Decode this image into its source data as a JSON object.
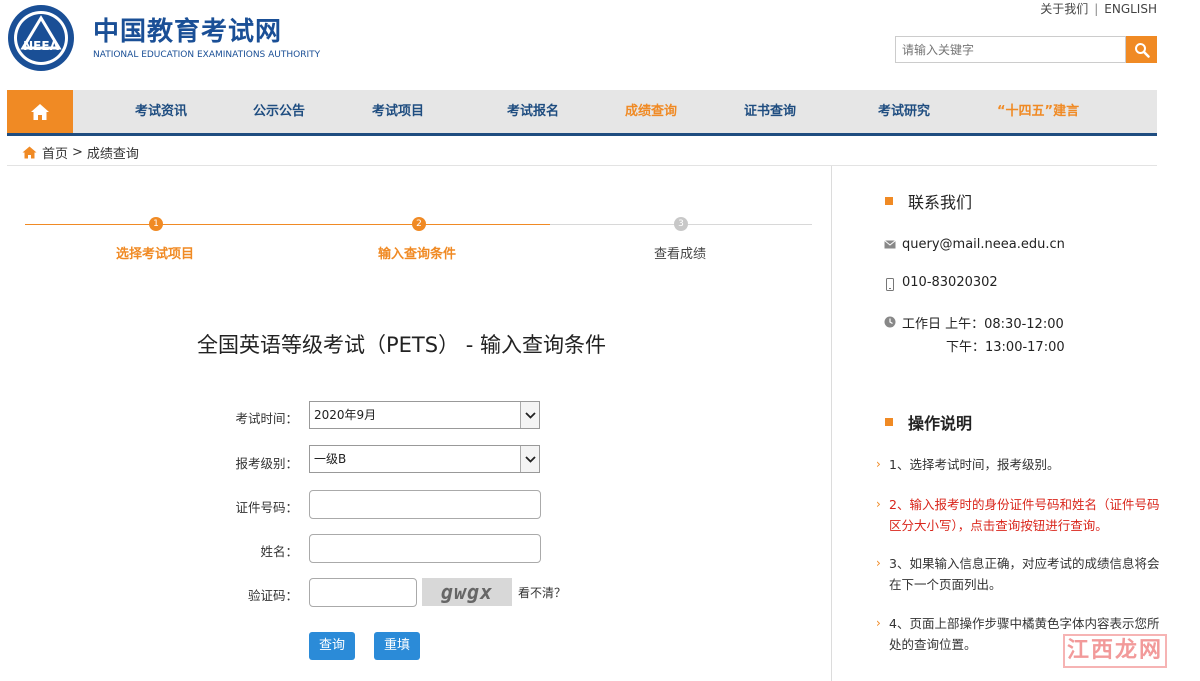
{
  "header": {
    "logo_cn": "中国教育考试网",
    "logo_en": "NATIONAL EDUCATION EXAMINATIONS AUTHORITY",
    "logo_badge": "NEEA",
    "top_links": {
      "about": "关于我们",
      "separator": "|",
      "english": "ENGLISH"
    },
    "search": {
      "placeholder": "请输入关键字",
      "icon": "search-icon"
    }
  },
  "nav": {
    "home_icon": "home-icon",
    "items": [
      {
        "label": "考试资讯"
      },
      {
        "label": "公示公告"
      },
      {
        "label": "考试项目"
      },
      {
        "label": "考试报名"
      },
      {
        "label": "成绩查询",
        "active": true
      },
      {
        "label": "证书查询"
      },
      {
        "label": "考试研究"
      },
      {
        "label": "“十四五”建言"
      }
    ],
    "colors": {
      "bar": "#e6e6e6",
      "text": "#1f4d80",
      "accent": "#f08a24"
    }
  },
  "breadcrumb": {
    "home": "首页",
    "separator": ">",
    "current": "成绩查询"
  },
  "steps": [
    {
      "num": "1",
      "label": "选择考试项目",
      "done": true
    },
    {
      "num": "2",
      "label": "输入查询条件",
      "done": true
    },
    {
      "num": "3",
      "label": "查看成绩",
      "done": false
    }
  ],
  "form": {
    "title": "全国英语等级考试（PETS） - 输入查询条件",
    "exam_time": {
      "label": "考试时间：",
      "value": "2020年9月"
    },
    "level": {
      "label": "报考级别：",
      "value": "一级B"
    },
    "id_number": {
      "label": "证件号码：",
      "value": ""
    },
    "name": {
      "label": "姓名：",
      "value": ""
    },
    "captcha": {
      "label": "验证码：",
      "value": "",
      "image_text": "gwgx",
      "refresh": "看不清？"
    },
    "query_button": "查询",
    "reset_button": "重填"
  },
  "sidebar": {
    "contact": {
      "title": "联系我们",
      "email": "query@mail.neea.edu.cn",
      "phone": "010-83020302",
      "hours_am": "工作日 上午：08:30-12:00",
      "hours_pm": "下午：13:00-17:00"
    },
    "instructions": {
      "title": "操作说明",
      "items": [
        {
          "text": "1、选择考试时间，报考级别。"
        },
        {
          "text": "2、输入报考时的身份证件号码和姓名（证件号码区分大小写），点击查询按钮进行查询。"
        },
        {
          "text": "3、如果输入信息正确，对应考试的成绩信息将会在下一个页面列出。"
        },
        {
          "text": "4、页面上部操作步骤中橘黄色字体内容表示您所处的查询位置。"
        }
      ]
    }
  },
  "watermark": "江西龙网"
}
